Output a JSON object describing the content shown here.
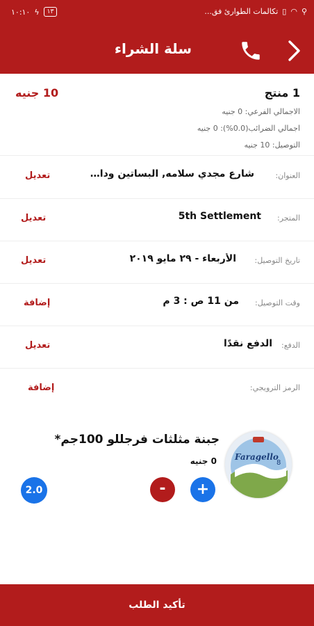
{
  "status_bar": {
    "carrier": "تكالمات الطوارئ فق...",
    "battery": "١٣",
    "time": "١٠:١٠"
  },
  "header": {
    "title": "سلة الشراء"
  },
  "summary": {
    "product_count": "1 منتج",
    "total": "10 جنيه",
    "subtotal": "الاجمالي الفرعي: 0 جنيه",
    "taxes": "اجمالي الضرائب(0.0%): 0 جنيه",
    "delivery": "التوصيل: 10 جنيه"
  },
  "details": {
    "address": {
      "label": "العنوان:",
      "value": "شارع مجدي سلامه, البساتين ودار السلام",
      "action": "تعديل"
    },
    "store": {
      "label": "المتجر:",
      "value": "5th Settlement",
      "action": "تعديل"
    },
    "delivery_date": {
      "label": "تاريخ التوصيل:",
      "value": "الأربعاء - ٢٩ مايو ٢٠١٩",
      "action": "تعديل"
    },
    "delivery_time": {
      "label": "وقت التوصيل:",
      "value": "من 11 ص : 3 م",
      "action": "إضافة"
    },
    "payment": {
      "label": "الدفع:",
      "value": "الدفع نقدًا",
      "action": "تعديل"
    },
    "promo": {
      "label": "الرمز الترويجي:",
      "action": "إضافة"
    }
  },
  "product": {
    "name": "جبنة مثلثات فرجللو 100جم*",
    "price": "0 جنيه",
    "brand": "Faragello",
    "pack": "8",
    "plus": "+",
    "minus": "-",
    "quantity": "2.0"
  },
  "footer": {
    "confirm": "تأكيد الطلب"
  },
  "colors": {
    "brand_red": "#b21c1c",
    "accent_blue": "#1a73e8"
  }
}
